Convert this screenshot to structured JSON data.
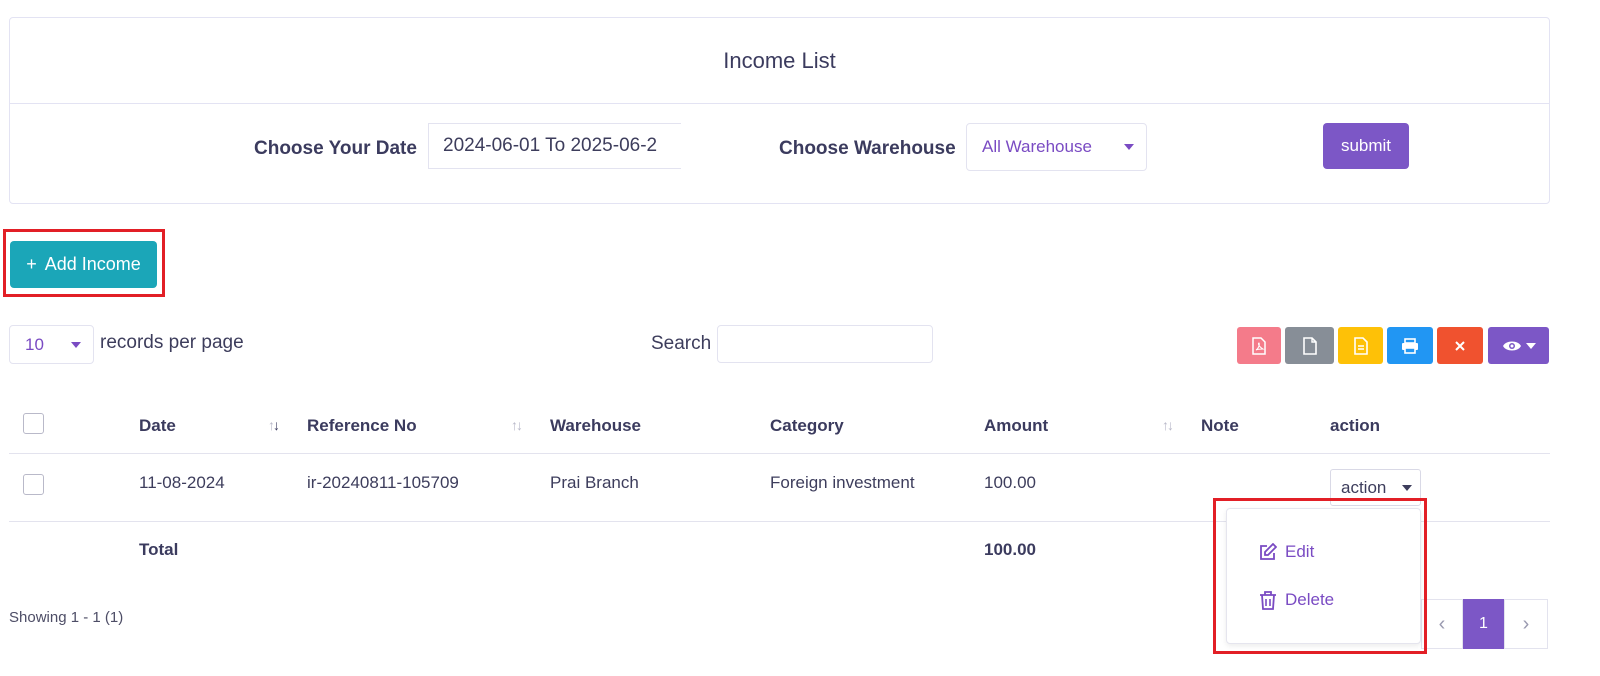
{
  "header": {
    "title": "Income List"
  },
  "filters": {
    "date_label": "Choose Your Date",
    "date_value": "2024-06-01 To 2025-06-2",
    "warehouse_label": "Choose Warehouse",
    "warehouse_value": "All Warehouse",
    "submit_label": "submit"
  },
  "actions": {
    "add_label": "Add Income",
    "add_icon": "+"
  },
  "table_controls": {
    "per_page_value": "10",
    "per_page_label": "records per page",
    "search_label": "Search",
    "search_value": "",
    "toolbar": [
      "pdf-icon",
      "csv-icon",
      "excel-icon",
      "print-icon",
      "close-icon",
      "eye-icon"
    ]
  },
  "table": {
    "columns": [
      "Date",
      "Reference No",
      "Warehouse",
      "Category",
      "Amount",
      "Note",
      "action"
    ],
    "rows": [
      {
        "date": "11-08-2024",
        "reference": "ir-20240811-105709",
        "warehouse": "Prai Branch",
        "category": "Foreign investment",
        "amount": "100.00",
        "note": "",
        "action_label": "action"
      }
    ],
    "footer": {
      "label": "Total",
      "amount": "100.00"
    }
  },
  "action_menu": {
    "edit_label": "Edit",
    "delete_label": "Delete"
  },
  "pagination": {
    "info": "Showing 1 - 1 (1)",
    "current_page": "1",
    "prev": "‹",
    "next": "›"
  },
  "colors": {
    "primary": "#7c57c6",
    "add_button": "#1ba6b8",
    "highlight": "#e21f26",
    "pdf": "#f47b8a",
    "csv": "#878e97",
    "excel": "#fec107",
    "print": "#2196f3",
    "close": "#f0522f",
    "visibility": "#7c57c6"
  }
}
